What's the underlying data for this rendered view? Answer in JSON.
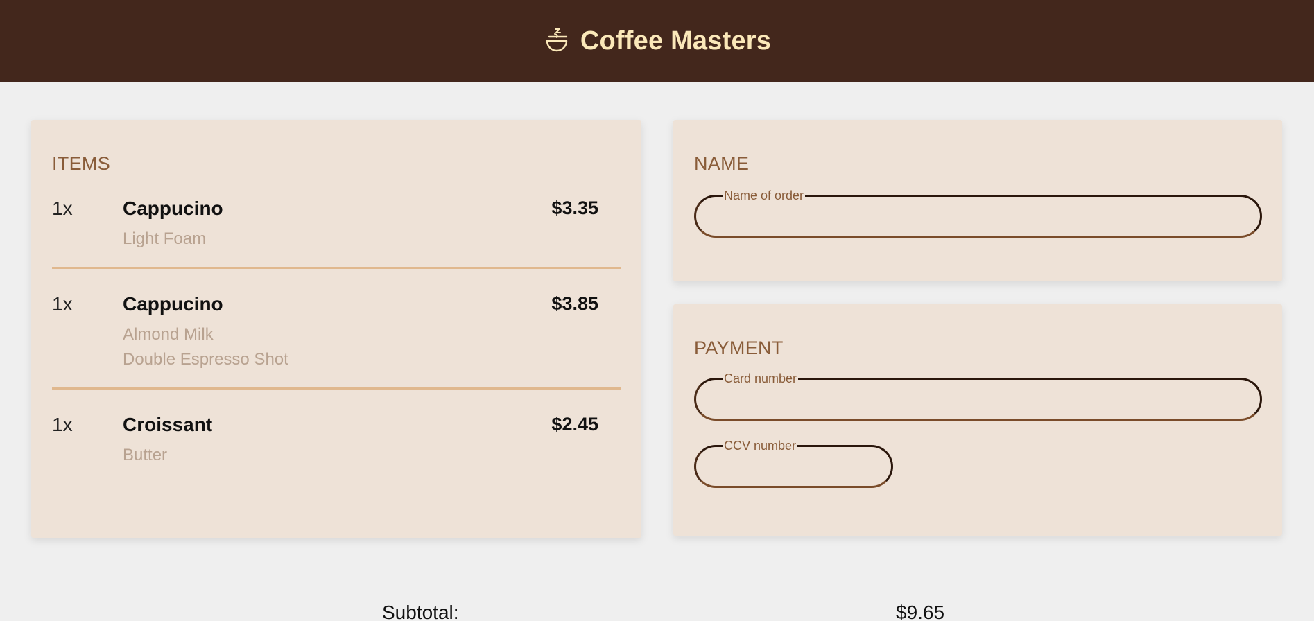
{
  "header": {
    "title": "Coffee Masters",
    "logo_icon": "coffee-cup-icon"
  },
  "items": {
    "title": "ITEMS",
    "list": [
      {
        "qty": "1x",
        "name": "Cappucino",
        "price": "$3.35",
        "options": [
          "Light Foam"
        ]
      },
      {
        "qty": "1x",
        "name": "Cappucino",
        "price": "$3.85",
        "options": [
          "Almond Milk",
          "Double Espresso Shot"
        ]
      },
      {
        "qty": "1x",
        "name": "Croissant",
        "price": "$2.45",
        "options": [
          "Butter"
        ]
      }
    ]
  },
  "name_section": {
    "title": "NAME",
    "name_field": {
      "label": "Name of order",
      "value": ""
    }
  },
  "payment": {
    "title": "PAYMENT",
    "card_field": {
      "label": "Card number",
      "value": ""
    },
    "ccv_field": {
      "label": "CCV number",
      "value": ""
    }
  },
  "totals": {
    "subtotal_label": "Subtotal:",
    "subtotal_value": "$9.65"
  },
  "colors": {
    "header_bg": "#43271c",
    "header_text": "#fbe8b9",
    "card_bg": "#eee2d7",
    "accent": "#895c39",
    "divider": "#e0b88e",
    "muted": "#b8a290"
  }
}
